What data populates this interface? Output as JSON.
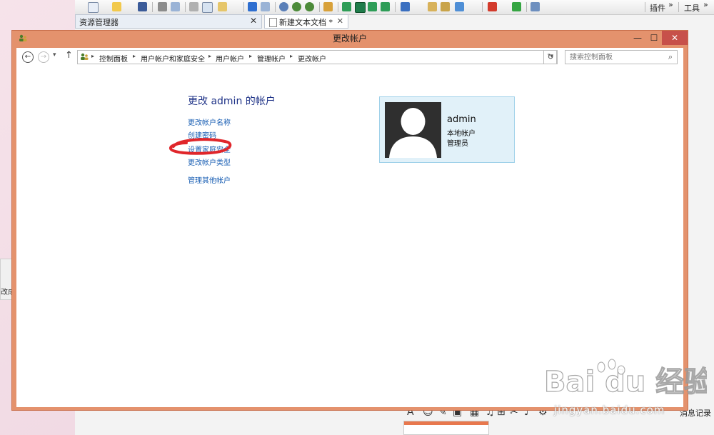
{
  "background_app": {
    "toolbar": {
      "plugins_label": "插件",
      "tools_label": "工具",
      "overflow": "»"
    },
    "panel": {
      "title": "资源管理器",
      "close": "✕"
    },
    "tab": {
      "title": "新建文本文档 *",
      "close": "✕"
    },
    "left_sliver_text": "改成",
    "bottom_bar": {
      "text": "消息记录",
      "icons": [
        "A",
        "☺",
        "✎",
        "▣",
        "▦",
        "♫",
        "⊞",
        "✂",
        "♪",
        "⚙"
      ]
    }
  },
  "window": {
    "title": "更改帐户",
    "controls": {
      "minimize": "—",
      "maximize": "☐",
      "close": "✕"
    }
  },
  "address_bar": {
    "back": "←",
    "forward": "→",
    "recent": "▾",
    "up": "↑",
    "breadcrumbs": [
      "控制面板",
      "用户帐户和家庭安全",
      "用户帐户",
      "管理帐户",
      "更改帐户"
    ],
    "separator": "▸",
    "dropdown": "▾",
    "refresh": "↻"
  },
  "search": {
    "placeholder": "搜索控制面板",
    "icon": "⌕"
  },
  "content": {
    "heading": "更改 admin 的帐户",
    "links": [
      "更改帐户名称",
      "创建密码",
      "设置家庭安全",
      "更改帐户类型",
      "管理其他帐户"
    ]
  },
  "account": {
    "name": "admin",
    "type": "本地帐户",
    "role": "管理员"
  },
  "watermark": {
    "brand": "Bai du 经验",
    "url": "jingyan.baidu.com"
  },
  "colors": {
    "window_frame": "#e4926d",
    "close_button": "#c7504a",
    "link": "#1a5fb4",
    "heading": "#1e3287",
    "tile_bg": "#e1f1f9",
    "annotation": "#e0262b"
  }
}
